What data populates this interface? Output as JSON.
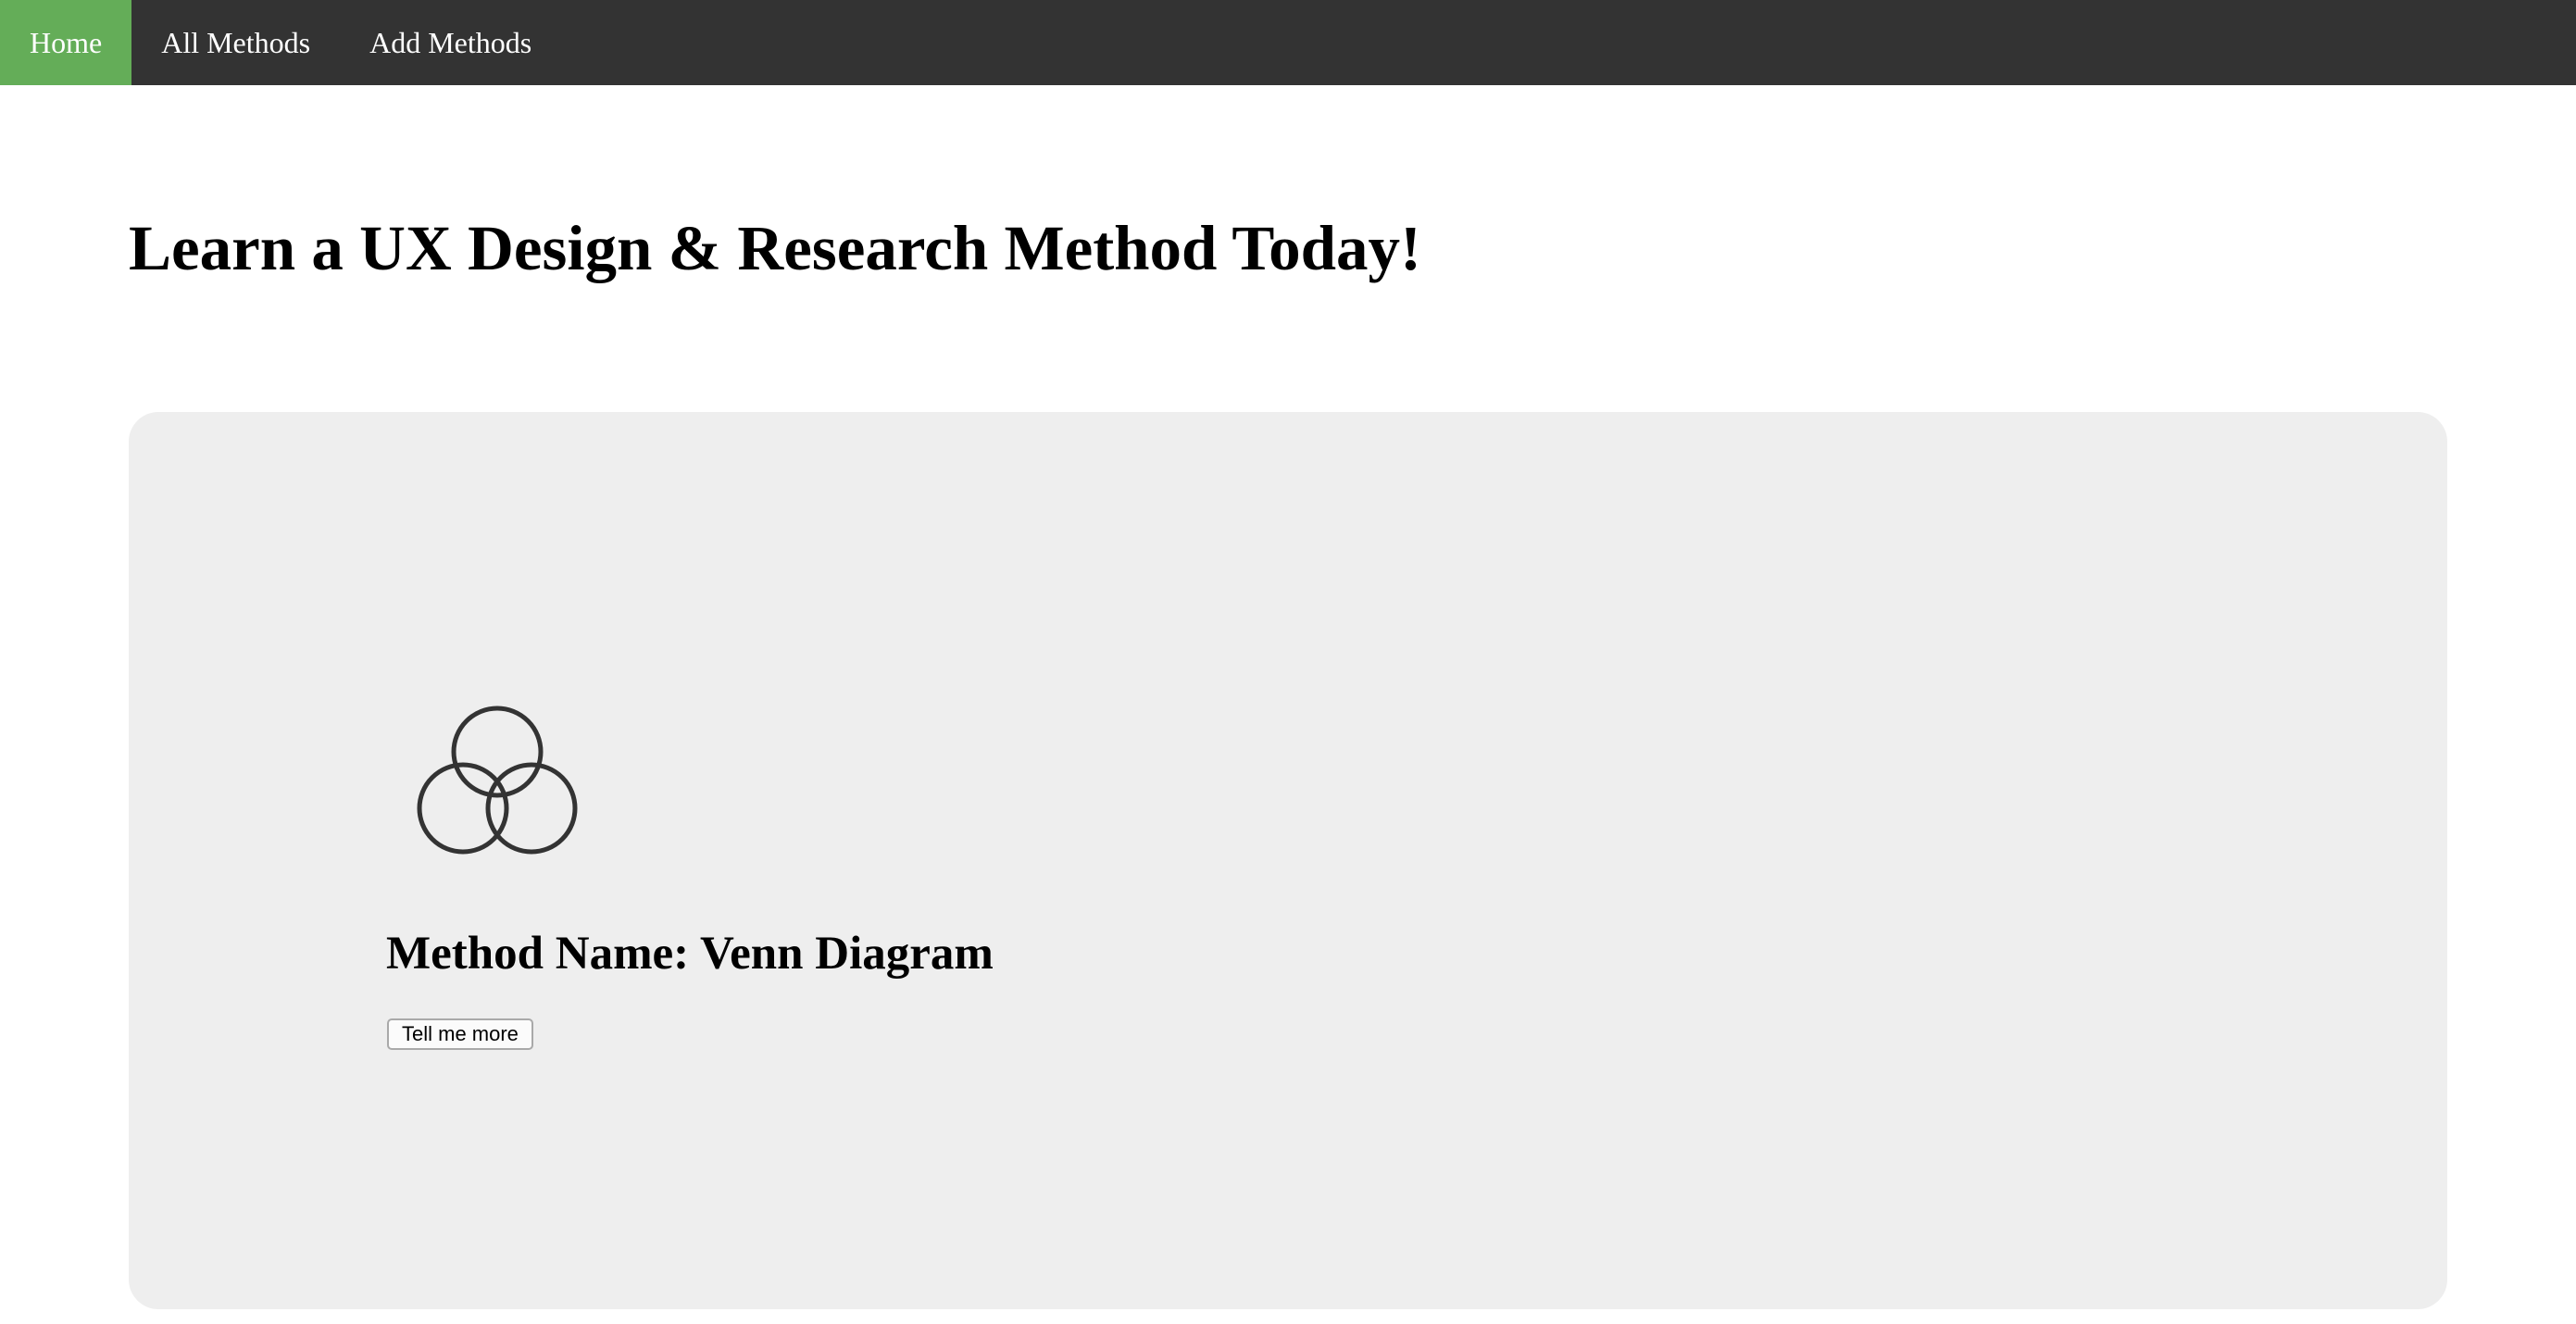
{
  "nav": {
    "items": [
      {
        "label": "Home",
        "active": true
      },
      {
        "label": "All Methods",
        "active": false
      },
      {
        "label": "Add Methods",
        "active": false
      }
    ]
  },
  "main": {
    "title": "Learn a UX Design & Research Method Today!"
  },
  "card": {
    "icon": "venn-diagram-icon",
    "method_name": "Method Name: Venn Diagram",
    "button_label": "Tell me more"
  },
  "colors": {
    "nav_background": "#333333",
    "nav_active": "#64ad58",
    "card_background": "#eeeeee"
  }
}
